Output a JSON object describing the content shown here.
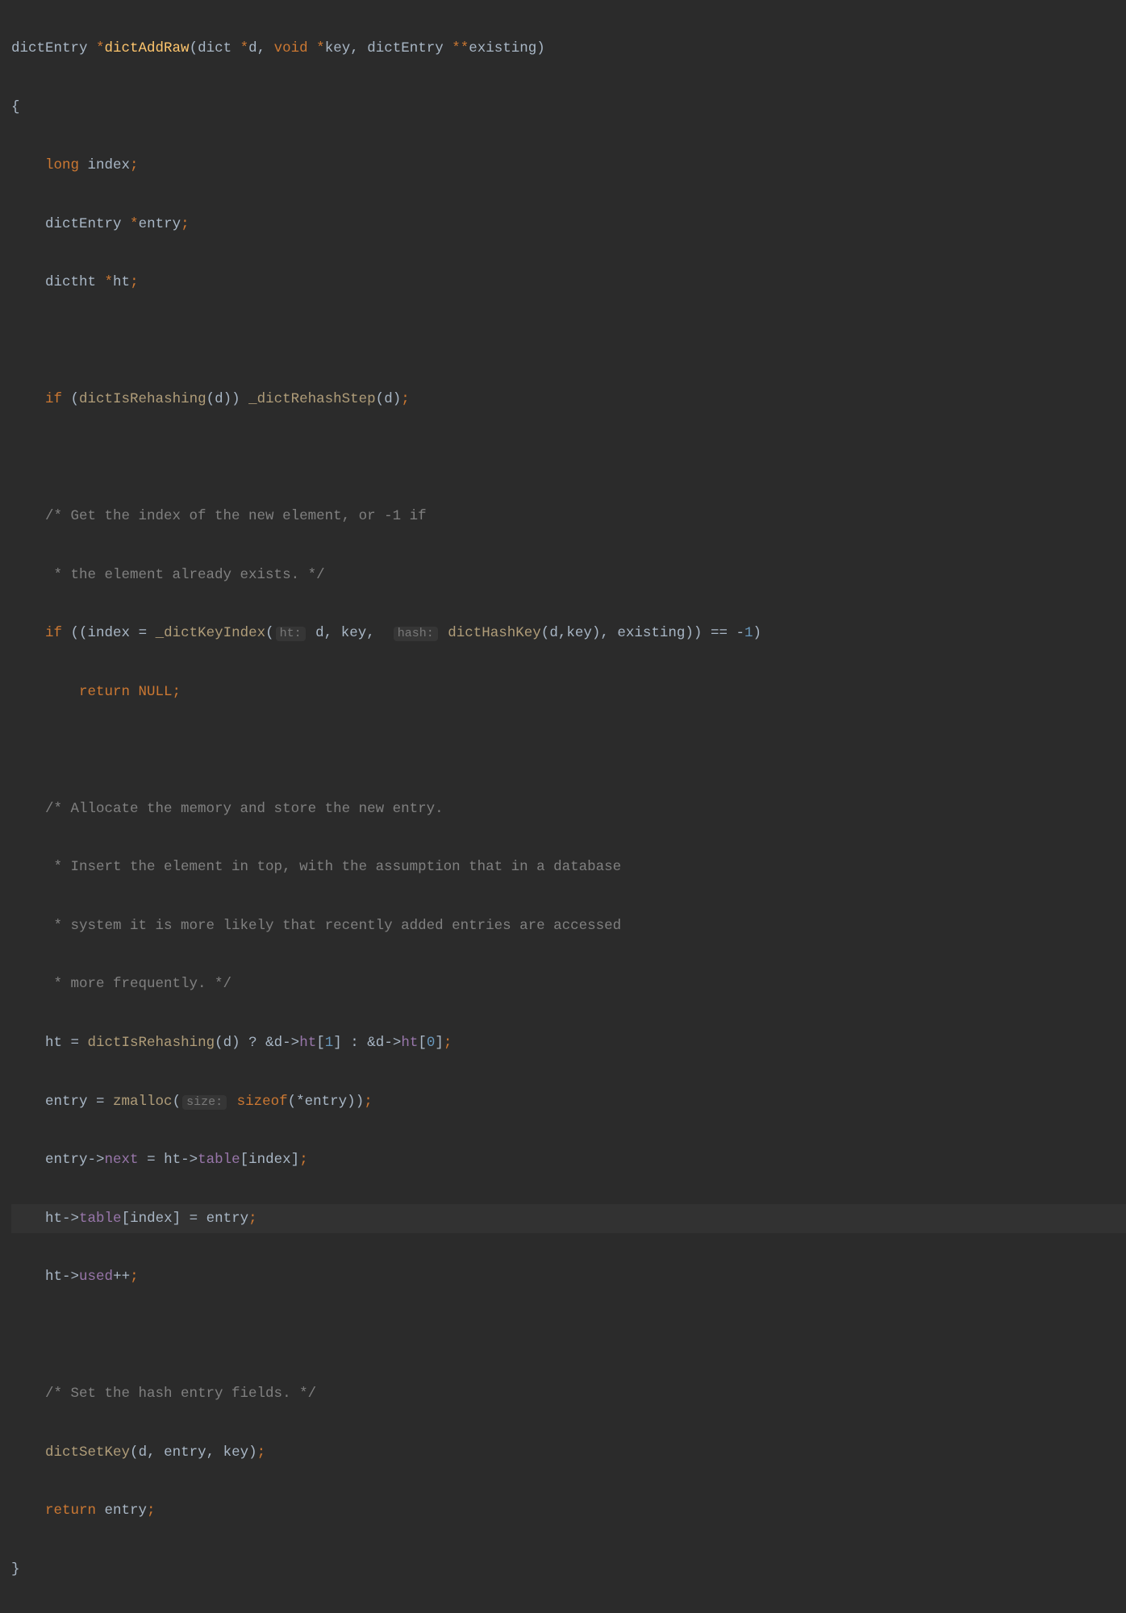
{
  "code": {
    "l1": {
      "ret_type": "dictEntry ",
      "star": "*",
      "fname": "dictAddRaw",
      "oparen": "(",
      "p1_type": "dict ",
      "p1_star": "*",
      "p1_name": "d",
      "c1": ", ",
      "p2_kw": "void ",
      "p2_star": "*",
      "p2_name": "key",
      "c2": ", ",
      "p3_type": "dictEntry ",
      "p3_star": "**",
      "p3_name": "existing",
      "cparen": ")"
    },
    "l2": {
      "brace": "{"
    },
    "l3": {
      "kw": "long ",
      "name": "index",
      "semi": ";"
    },
    "l4": {
      "type": "dictEntry ",
      "star": "*",
      "name": "entry",
      "semi": ";"
    },
    "l5": {
      "type": "dictht ",
      "star": "*",
      "name": "ht",
      "semi": ";"
    },
    "l6": {
      "empty": ""
    },
    "l7": {
      "kw": "if ",
      "op": "(",
      "call1": "dictIsRehashing",
      "op1": "(",
      "arg1": "d",
      "cp1": ")",
      "cp": ") ",
      "call2": "_dictRehashStep",
      "op2": "(",
      "arg2": "d",
      "cp2": ")",
      "semi": ";"
    },
    "l8": {
      "empty": ""
    },
    "l9": {
      "c": "/* Get the index of the new element, or -1 if"
    },
    "l10": {
      "c": " * the element already exists. */"
    },
    "l11": {
      "kw": "if ",
      "op": "((",
      "lhs": "index ",
      "eq": "= ",
      "call": "_dictKeyIndex",
      "op1": "(",
      "hint1": "ht:",
      "sp1": " ",
      "a1": "d",
      "c1": ", ",
      "a2": "key",
      "c2": ", ",
      "hint2": "hash:",
      "sp2": " ",
      "call2": "dictHashKey",
      "op2": "(",
      "b1": "d",
      "c3": ",",
      "b2": "key",
      "cp2": ")",
      "c4": ", ",
      "a3": "existing",
      "cp1": "))",
      "sp3": " ",
      "cmp": "== ",
      "neg": "-",
      "num": "1",
      "cp": ")"
    },
    "l12": {
      "kw": "return ",
      "val": "NULL",
      "semi": ";"
    },
    "l13": {
      "empty": ""
    },
    "l14": {
      "c": "/* Allocate the memory and store the new entry."
    },
    "l15": {
      "c": " * Insert the element in top, with the assumption that in a database"
    },
    "l16": {
      "c": " * system it is more likely that recently added entries are accessed"
    },
    "l17": {
      "c": " * more frequently. */"
    },
    "l18": {
      "lhs": "ht ",
      "eq": "= ",
      "call": "dictIsRehashing",
      "op1": "(",
      "a1": "d",
      "cp1": ") ",
      "q": "? ",
      "amp1": "&",
      "d1": "d",
      "arr1": "->",
      "m1": "ht",
      "br1o": "[",
      "n1": "1",
      "br1c": "]",
      "sp1": " ",
      "colon": ": ",
      "amp2": "&",
      "d2": "d",
      "arr2": "->",
      "m2": "ht",
      "br2o": "[",
      "n2": "0",
      "br2c": "]",
      "semi": ";"
    },
    "l19": {
      "lhs": "entry ",
      "eq": "= ",
      "call": "zmalloc",
      "op1": "(",
      "hint": "size:",
      "sp": " ",
      "kw": "sizeof",
      "op2": "(",
      "star": "*",
      "a1": "entry",
      "cp2": ")",
      "cp1": ")",
      "semi": ";"
    },
    "l20": {
      "lhs": "entry",
      "arr": "->",
      "m": "next",
      "sp": " ",
      "eq": "= ",
      "rhs": "ht",
      "arr2": "->",
      "m2": "table",
      "br_o": "[",
      "idx": "index",
      "br_c": "]",
      "semi": ";"
    },
    "l21": {
      "lhs": "ht",
      "arr": "->",
      "m": "table",
      "br_o": "[",
      "idx": "index",
      "br_c": "]",
      "sp": " ",
      "eq": "= ",
      "rhs": "entry",
      "semi": ";"
    },
    "l22": {
      "lhs": "ht",
      "arr": "->",
      "m": "used",
      "inc": "++",
      "semi": ";"
    },
    "l23": {
      "empty": ""
    },
    "l24": {
      "c": "/* Set the hash entry fields. */"
    },
    "l25": {
      "call": "dictSetKey",
      "op": "(",
      "a1": "d",
      "c1": ", ",
      "a2": "entry",
      "c2": ", ",
      "a3": "key",
      "cp": ")",
      "semi": ";"
    },
    "l26": {
      "kw": "return ",
      "val": "entry",
      "semi": ";"
    },
    "l27": {
      "brace": "}"
    }
  },
  "indent1": "    ",
  "indent2": "        "
}
